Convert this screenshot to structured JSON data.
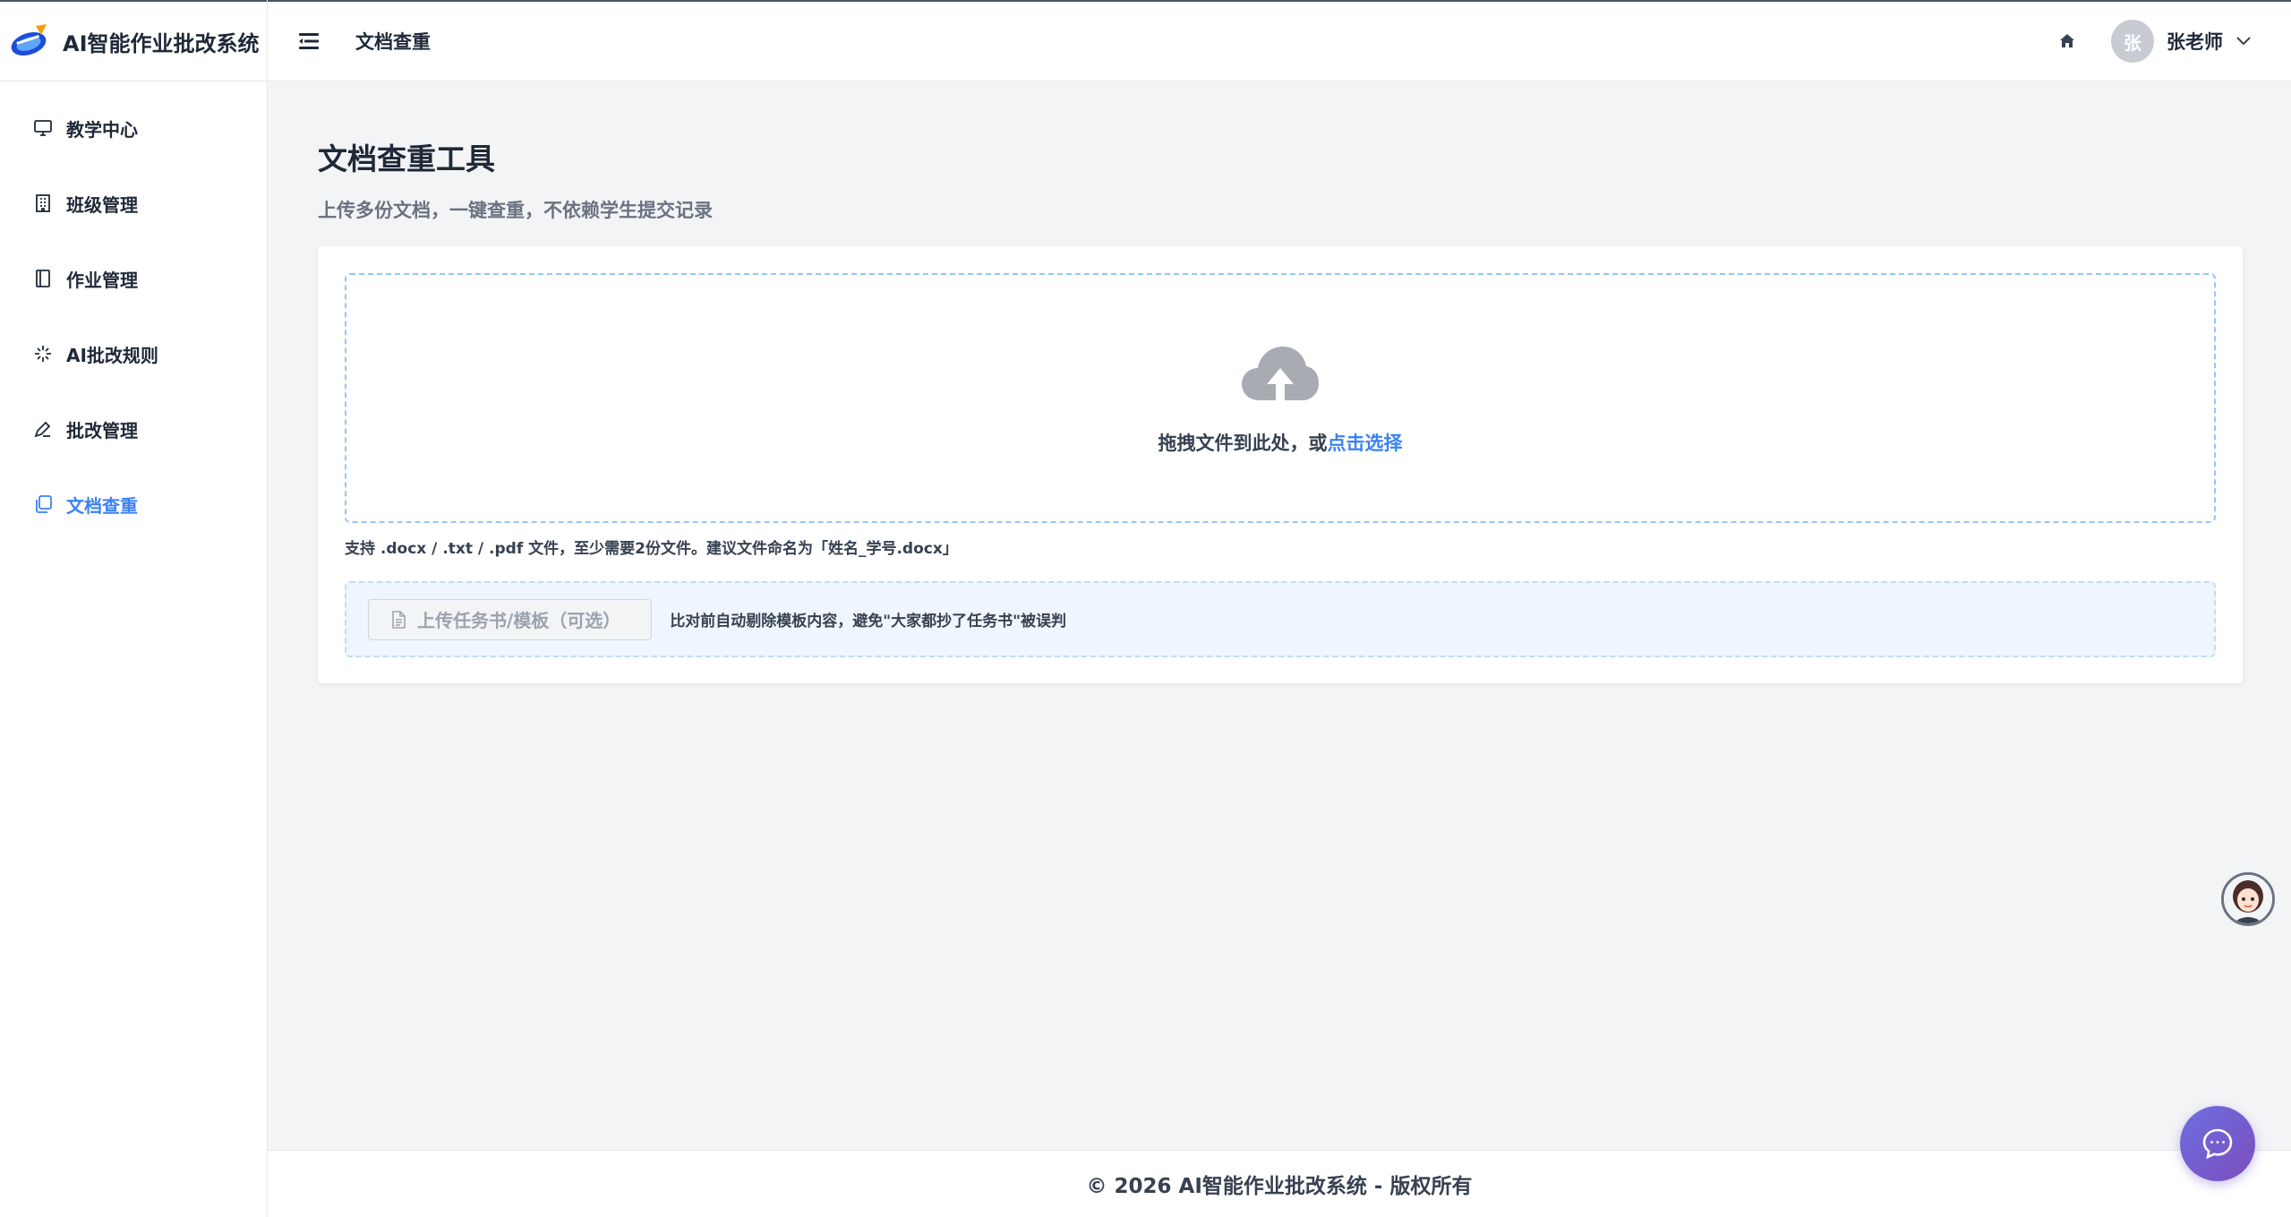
{
  "app": {
    "title": "AI智能作业批改系统"
  },
  "sidebar": {
    "items": [
      {
        "label": "教学中心",
        "icon": "monitor-icon",
        "active": false
      },
      {
        "label": "班级管理",
        "icon": "building-icon",
        "active": false
      },
      {
        "label": "作业管理",
        "icon": "notebook-icon",
        "active": false
      },
      {
        "label": "AI批改规则",
        "icon": "sparkle-icon",
        "active": false
      },
      {
        "label": "批改管理",
        "icon": "pen-icon",
        "active": false
      },
      {
        "label": "文档查重",
        "icon": "copy-icon",
        "active": true
      }
    ]
  },
  "header": {
    "title": "文档查重",
    "user": {
      "avatar_text": "张",
      "name": "张老师"
    }
  },
  "main": {
    "title": "文档查重工具",
    "subtitle": "上传多份文档，一键查重，不依赖学生提交记录",
    "dropzone": {
      "text": "拖拽文件到此处，或",
      "link": "点击选择"
    },
    "hint": "支持 .docx / .txt / .pdf 文件，至少需要2份文件。建议文件命名为「姓名_学号.docx」",
    "template": {
      "button_label": "上传任务书/模板（可选）",
      "note": "比对前自动剔除模板内容，避免\"大家都抄了任务书\"被误判"
    }
  },
  "footer": {
    "text": "© 2026 AI智能作业批改系统 - 版权所有"
  },
  "colors": {
    "accent": "#3b82f6",
    "chat_fab": "#7c4dbe"
  }
}
